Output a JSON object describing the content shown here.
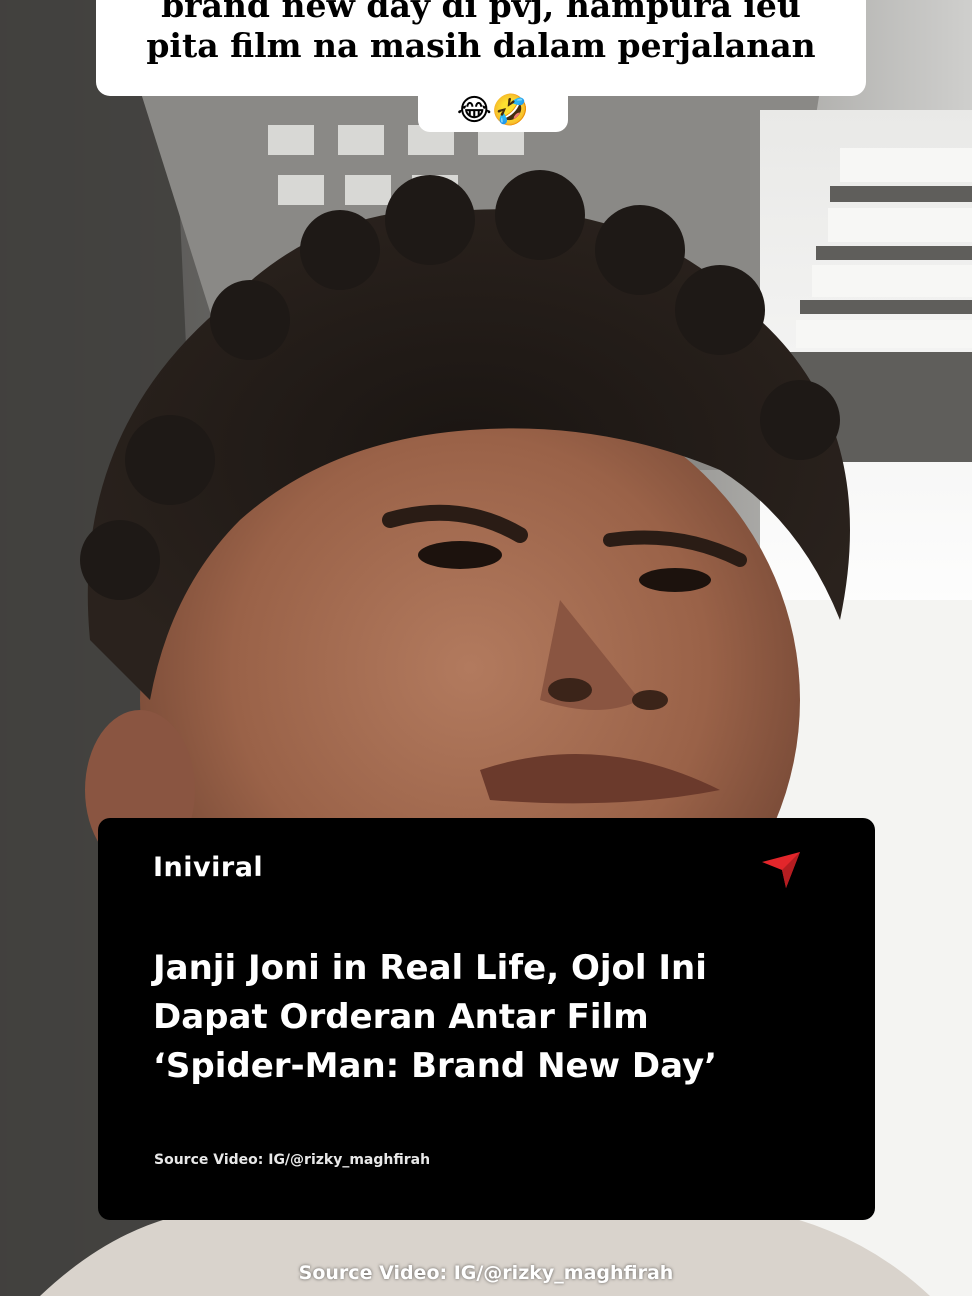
{
  "overlay_caption": {
    "line1": "brand new day di pvj, hampura ieu",
    "line2": "pita film na masih dalam perjalanan",
    "emoji": "😂🤣"
  },
  "news_card": {
    "brand": "Iniviral",
    "headline_line1": "Janji Joni in Real Life, Ojol Ini",
    "headline_line2": "Dapat Orderan Antar Film",
    "headline_line3": "‘Spider-Man: Brand New Day’",
    "source": "Source Video: IG/@rizky_maghfirah",
    "icon": "send-icon",
    "accent_color": "#e3262b"
  },
  "bottom_source": "Source Video: IG/@rizky_maghfirah"
}
